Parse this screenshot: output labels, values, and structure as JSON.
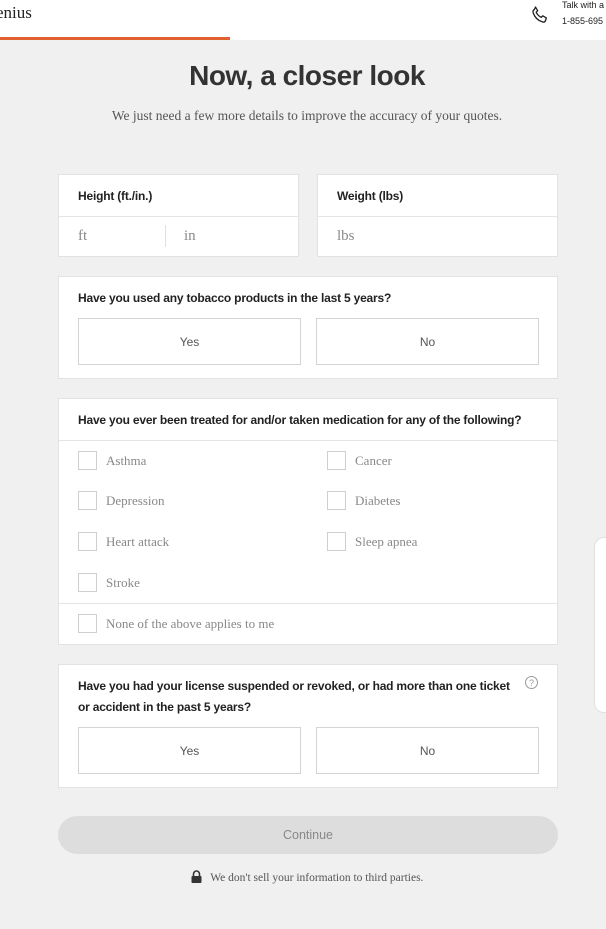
{
  "header": {
    "brand": "enius",
    "talk_label": "Talk with a",
    "phone": "1-855-695",
    "progress_color": "#e0612e",
    "progress_fraction": 0.38
  },
  "page": {
    "title": "Now, a closer look",
    "subtitle": "We just need a few more details to improve the accuracy of your quotes."
  },
  "height_card": {
    "label": "Height (ft./in.)",
    "ft_placeholder": "ft",
    "in_placeholder": "in"
  },
  "weight_card": {
    "label": "Weight (lbs)",
    "lbs_placeholder": "lbs"
  },
  "tobacco": {
    "question": "Have you used any tobacco products in the last 5 years?",
    "yes": "Yes",
    "no": "No"
  },
  "medical": {
    "question": "Have you ever been treated for and/or taken medication for any of the following?",
    "conditions": [
      "Asthma",
      "Cancer",
      "Depression",
      "Diabetes",
      "Heart attack",
      "Sleep apnea",
      "Stroke"
    ],
    "none_option": "None of the above applies to me"
  },
  "license": {
    "question_line1": "Have you had your license suspended or revoked, or had more than one ticket",
    "question_line2": "or accident in the past 5 years?",
    "help_glyph": "?",
    "yes": "Yes",
    "no": "No"
  },
  "footer": {
    "continue_label": "Continue",
    "privacy_text": "We don't sell your information to third parties."
  }
}
